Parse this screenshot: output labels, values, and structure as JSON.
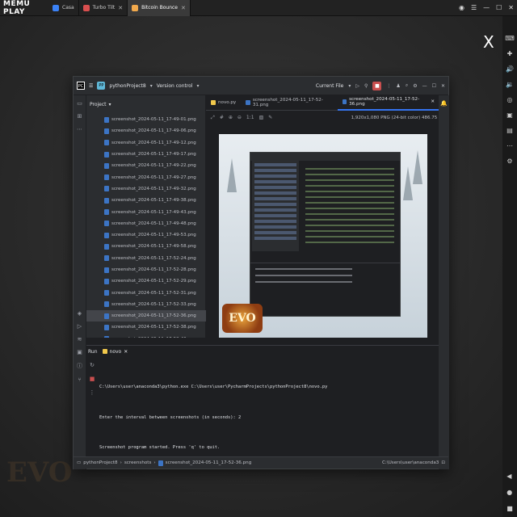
{
  "emulator": {
    "logo": "MEMU PLAY",
    "tabs": [
      {
        "label": "Casa"
      },
      {
        "label": "Turbo Tilt"
      },
      {
        "label": "Bitcoin Bounce"
      }
    ],
    "close_label": "X"
  },
  "ide": {
    "project_name": "pythonProject8",
    "project_badge": "PP",
    "vcs_label": "Version control",
    "run_config": "Current File",
    "project_panel_title": "Project",
    "files": [
      "screenshot_2024-05-11_17-49-01.png",
      "screenshot_2024-05-11_17-49-06.png",
      "screenshot_2024-05-11_17-49-12.png",
      "screenshot_2024-05-11_17-49-17.png",
      "screenshot_2024-05-11_17-49-22.png",
      "screenshot_2024-05-11_17-49-27.png",
      "screenshot_2024-05-11_17-49-32.png",
      "screenshot_2024-05-11_17-49-38.png",
      "screenshot_2024-05-11_17-49-43.png",
      "screenshot_2024-05-11_17-49-48.png",
      "screenshot_2024-05-11_17-49-53.png",
      "screenshot_2024-05-11_17-49-58.png",
      "screenshot_2024-05-11_17-52-24.png",
      "screenshot_2024-05-11_17-52-28.png",
      "screenshot_2024-05-11_17-52-29.png",
      "screenshot_2024-05-11_17-52-31.png",
      "screenshot_2024-05-11_17-52-33.png",
      "screenshot_2024-05-11_17-52-36.png",
      "screenshot_2024-05-11_17-52-38.png",
      "screenshot_2024-05-11_17-52-40.png"
    ],
    "selected_file_index": 17,
    "editor_tabs": [
      {
        "label": "novo.py"
      },
      {
        "label": "screenshot_2024-05-11_17-52-31.png"
      },
      {
        "label": "screenshot_2024-05-11_17-52-36.png"
      }
    ],
    "image_info": "1,920x1,080 PNG (24-bit color) 486.75 kB",
    "preview_logo": "EVO",
    "run_title": "Run",
    "run_tab": "novo",
    "console_lines": [
      "C:\\Users\\user\\anaconda3\\python.exe C:\\Users\\user\\PycharmProjects\\pythonProject8\\novo.py",
      "Enter the interval between screenshots (in seconds): 2",
      "Screenshot program started. Press 'q' to quit."
    ],
    "breadcrumb": [
      "pythonProject8",
      "screenshots",
      "screenshot_2024-05-11_17-52-36.png"
    ],
    "interpreter": "C:\\Users\\user\\anaconda3"
  },
  "colors": {
    "accent": "#3574f0",
    "run_red": "#c94f4f"
  }
}
